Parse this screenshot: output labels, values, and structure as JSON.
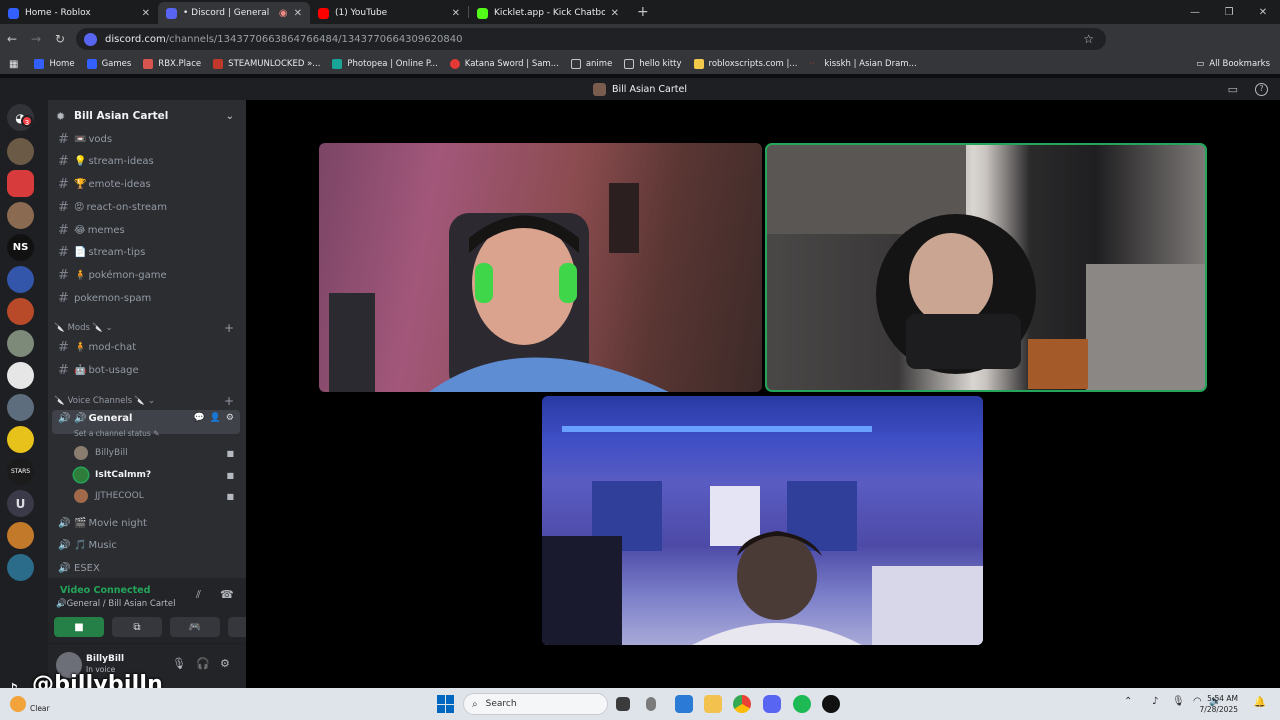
{
  "browser": {
    "tabs": [
      {
        "title": "Home - Roblox",
        "color": "#335fff",
        "active": false
      },
      {
        "title": "• Discord | General | Bill",
        "color": "#5865f2",
        "active": true
      },
      {
        "title": "(1) YouTube",
        "color": "#ff0000",
        "active": false
      },
      {
        "title": "Kicklet.app - Kick Chatbot and",
        "color": "#53fc18",
        "active": false
      }
    ],
    "new_tab": "+",
    "url_host": "discord.com",
    "url_path": "/channels/1343770663864766484/1343770664309620840",
    "bookmarks": [
      {
        "label": "Home",
        "color": "#335fff"
      },
      {
        "label": "Games",
        "color": "#335fff"
      },
      {
        "label": "RBX.Place",
        "color": "#d9534f"
      },
      {
        "label": "STEAMUNLOCKED »...",
        "color": "#c0392b"
      },
      {
        "label": "Photopea | Online P...",
        "color": "#18a497"
      },
      {
        "label": "Katana Sword | Sam...",
        "color": "#e53935"
      },
      {
        "label": "anime",
        "color": "#8a8a8a"
      },
      {
        "label": "hello kitty",
        "color": "#8a8a8a"
      },
      {
        "label": "robloxscripts.com |...",
        "color": "#f2c94c"
      },
      {
        "label": "kisskh | Asian Dram...",
        "color": "#c0392b"
      }
    ],
    "all_bookmarks": "All Bookmarks"
  },
  "discord": {
    "window_title": "Bill Asian Cartel",
    "server_name": "Bill Asian Cartel",
    "servers": [
      {
        "color": "#5865f2",
        "badge": "3"
      },
      {
        "color": "#6b5a45"
      },
      {
        "color": "#d83b3b"
      },
      {
        "color": "#8a6a50"
      },
      {
        "color": "#111111"
      },
      {
        "color": "#3355aa"
      },
      {
        "color": "#b84a2a"
      },
      {
        "color": "#7d8a7a"
      },
      {
        "color": "#e6e6e6"
      },
      {
        "color": "#5e6d7e"
      },
      {
        "color": "#e6c21a"
      },
      {
        "color": "#1b1b1b"
      },
      {
        "color": "#3a3a48"
      },
      {
        "color": "#c27a2a"
      },
      {
        "color": "#2a6c8a"
      }
    ],
    "channels": [
      {
        "name": "vods",
        "emoji": "📼"
      },
      {
        "name": "stream-ideas",
        "emoji": "💡"
      },
      {
        "name": "emote-ideas",
        "emoji": "🏆"
      },
      {
        "name": "react-on-stream",
        "emoji": "😡"
      },
      {
        "name": "memes",
        "emoji": "😂"
      },
      {
        "name": "stream-tips",
        "emoji": "📄"
      },
      {
        "name": "pokémon-game",
        "emoji": "🧍"
      },
      {
        "name": "pokemon-spam",
        "emoji": ""
      }
    ],
    "mods_category": "Mods",
    "mods_channels": [
      {
        "name": "mod-chat",
        "emoji": "🧍"
      },
      {
        "name": "bot-usage",
        "emoji": "🤖"
      }
    ],
    "voice_category": "Voice Channels",
    "voice_general": "General",
    "voice_status": "Set a channel status",
    "voice_users": [
      {
        "name": "BillyBill",
        "color": "#8a7d70",
        "bold": false
      },
      {
        "name": "IsItCalmm?",
        "color": "#2f7d3a",
        "bold": true
      },
      {
        "name": "JJTHECOOL",
        "color": "#a06a4a",
        "bold": false
      }
    ],
    "voice_channels": [
      {
        "name": "Movie night",
        "emoji": "🎬"
      },
      {
        "name": "Music",
        "emoji": "🎵"
      },
      {
        "name": "ESEX",
        "emoji": ""
      }
    ],
    "voice_connected": "Video Connected",
    "voice_location": "General / Bill Asian Cartel",
    "user_name": "BillyBill",
    "user_status": "In voice"
  },
  "watermark": "@billybilln",
  "taskbar": {
    "weather": "Clear",
    "search": "Search",
    "time": "5:54 AM",
    "date": "7/28/2025"
  }
}
